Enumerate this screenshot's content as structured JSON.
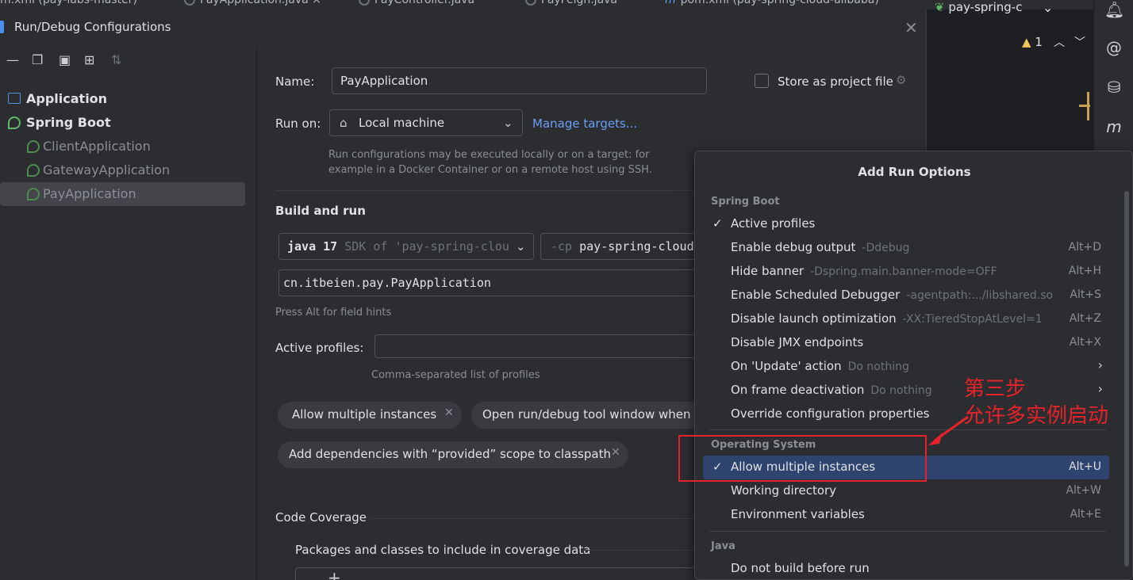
{
  "editor_tabs": [
    {
      "label": "m.xml (pay-labs-master)",
      "icon": "maven-icon"
    },
    {
      "label": "PayApplication.java",
      "icon": "class-icon"
    },
    {
      "label": "PayController.java",
      "icon": "class-icon"
    },
    {
      "label": "PayFeign.java",
      "icon": "interface-icon"
    },
    {
      "label": "pom.xml (pay-spring-cloud-alibaba)",
      "icon": "maven-icon"
    }
  ],
  "branch_widget": {
    "label": "pay-spring-c"
  },
  "editor": {
    "warning_count": "1"
  },
  "dialog": {
    "title": "Run/Debug Configurations",
    "tree": {
      "application_label": "Application",
      "spring_boot_label": "Spring Boot",
      "configs": [
        "ClientApplication",
        "GatewayApplication",
        "PayApplication"
      ]
    },
    "form": {
      "name_label": "Name:",
      "name_value": "PayApplication",
      "store_label": "Store as project file",
      "run_on_label": "Run on:",
      "run_on_value": "Local machine",
      "manage_targets": "Manage targets...",
      "run_on_hint_1": "Run configurations may be executed locally or on a target: for",
      "run_on_hint_2": "example in a Docker Container or on a remote host using SSH.",
      "build_and_run": "Build and run",
      "jdk_main": "java 17",
      "jdk_sub": "SDK of 'pay-spring-clou",
      "cp_prefix": "-cp",
      "cp_value": "pay-spring-cloud",
      "main_class": "cn.itbeien.pay.PayApplication",
      "alt_hint": "Press Alt for field hints",
      "active_profiles_label": "Active profiles:",
      "profiles_hint": "Comma-separated list of profiles",
      "chips": [
        "Allow multiple instances",
        "Open run/debug tool window when s",
        "Add dependencies with “provided” scope to classpath"
      ],
      "code_coverage": "Code Coverage",
      "coverage_packages": "Packages and classes to include in coverage data"
    }
  },
  "popup": {
    "title": "Add Run Options",
    "groups": [
      {
        "header": "Spring Boot",
        "items": [
          {
            "label": "Active profiles",
            "checked": "✓",
            "hint": "",
            "shortcut": ""
          },
          {
            "label": "Enable debug output",
            "hint": "-Ddebug",
            "shortcut": "Alt+D"
          },
          {
            "label": "Hide banner",
            "hint": "-Dspring.main.banner-mode=OFF",
            "shortcut": "Alt+H"
          },
          {
            "label": "Enable Scheduled Debugger",
            "hint": "-agentpath:.../libshared.so",
            "shortcut": "Alt+S"
          },
          {
            "label": "Disable launch optimization",
            "hint": "-XX:TieredStopAtLevel=1",
            "shortcut": "Alt+Z"
          },
          {
            "label": "Disable JMX endpoints",
            "hint": "",
            "shortcut": "Alt+X"
          },
          {
            "label": "On 'Update' action",
            "hint": "Do nothing",
            "shortcut": ""
          },
          {
            "label": "On frame deactivation",
            "hint": "Do nothing",
            "shortcut": ""
          },
          {
            "label": "Override configuration properties",
            "hint": "",
            "shortcut": ""
          }
        ]
      },
      {
        "header": "Operating System",
        "items": [
          {
            "label": "Allow multiple instances",
            "checked": "✓",
            "hint": "",
            "shortcut": "Alt+U"
          },
          {
            "label": "Working directory",
            "hint": "",
            "shortcut": "Alt+W"
          },
          {
            "label": "Environment variables",
            "hint": "",
            "shortcut": "Alt+E"
          }
        ]
      },
      {
        "header": "Java",
        "items": [
          {
            "label": "Do not build before run",
            "hint": "",
            "shortcut": ""
          }
        ]
      }
    ]
  },
  "annotation": {
    "line1": "第三步",
    "line2": "允许多实例启动",
    "color": "#e8222a"
  },
  "colors": {
    "accent": "#6b9ef5",
    "selection": "#2e436e",
    "spring": "#5fb865"
  }
}
